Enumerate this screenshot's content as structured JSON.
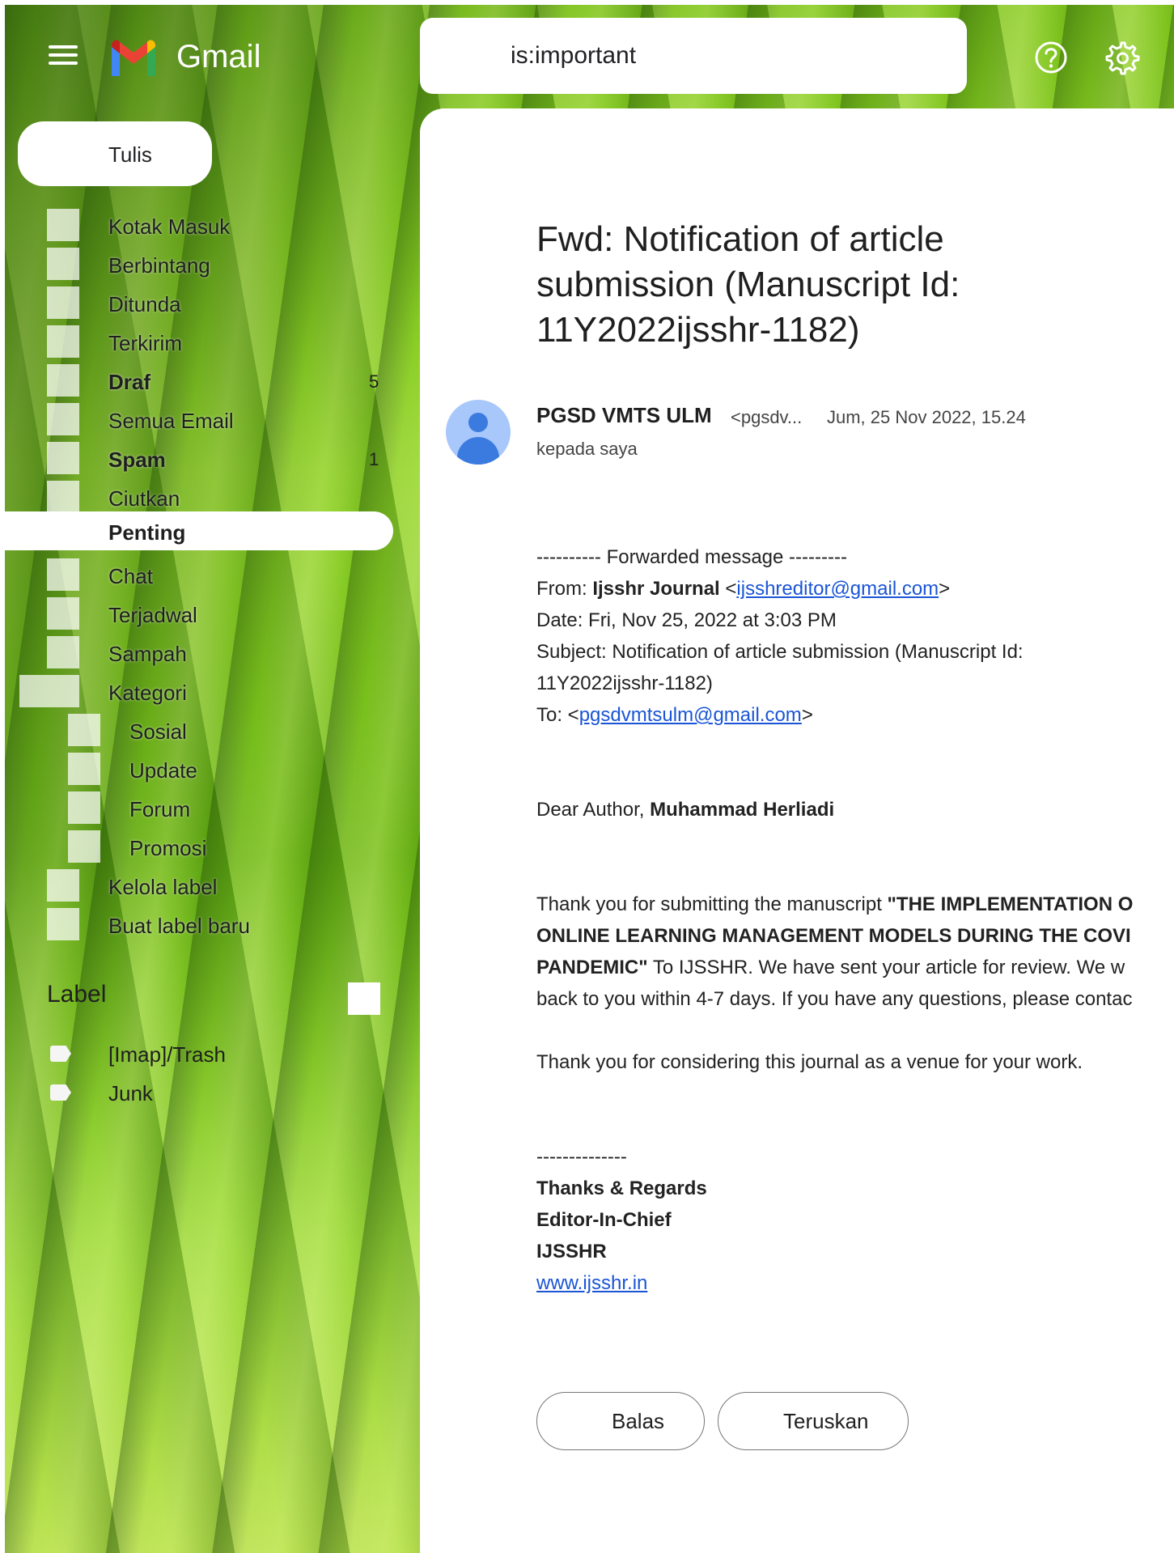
{
  "header": {
    "app_name": "Gmail",
    "search_value": "is:important"
  },
  "compose_label": "Tulis",
  "nav": [
    {
      "label": "Kotak Masuk",
      "count": "",
      "bold": false
    },
    {
      "label": "Berbintang",
      "count": "",
      "bold": false
    },
    {
      "label": "Ditunda",
      "count": "",
      "bold": false
    },
    {
      "label": "Terkirim",
      "count": "",
      "bold": false
    },
    {
      "label": "Draf",
      "count": "5",
      "bold": true
    },
    {
      "label": "Semua Email",
      "count": "",
      "bold": false
    },
    {
      "label": "Spam",
      "count": "1",
      "bold": true
    },
    {
      "label": "Ciutkan",
      "count": "",
      "bold": false
    },
    {
      "label": "Penting",
      "count": "",
      "bold": true,
      "active": true
    },
    {
      "label": "Chat",
      "count": "",
      "bold": false
    },
    {
      "label": "Terjadwal",
      "count": "",
      "bold": false
    },
    {
      "label": "Sampah",
      "count": "",
      "bold": false
    },
    {
      "label": "Kategori",
      "count": "",
      "bold": false
    },
    {
      "label": "Sosial",
      "count": "",
      "bold": false,
      "sub": true
    },
    {
      "label": "Update",
      "count": "",
      "bold": false,
      "sub": true
    },
    {
      "label": "Forum",
      "count": "",
      "bold": false,
      "sub": true
    },
    {
      "label": "Promosi",
      "count": "",
      "bold": false,
      "sub": true
    },
    {
      "label": "Kelola label",
      "count": "",
      "bold": false
    },
    {
      "label": "Buat label baru",
      "count": "",
      "bold": false
    }
  ],
  "labels": {
    "heading": "Label",
    "items": [
      "[Imap]/Trash",
      "Junk"
    ]
  },
  "email": {
    "subject": "Fwd: Notification of article submission (Manuscript Id: 11Y2022ijsshr-1182)",
    "sender_name": "PGSD VMTS ULM",
    "sender_email_short": "<pgsdv...",
    "date": "Jum, 25 Nov 2022, 15.24",
    "recipient": "kepada saya",
    "body": {
      "fwd_header": "---------- Forwarded message ---------",
      "from_label": "From: ",
      "from_name": "Ijsshr Journal",
      "from_email": "ijsshreditor@gmail.com",
      "date_line": "Date: Fri, Nov 25, 2022 at 3:03 PM",
      "subject_line_1": "Subject: Notification of article submission (Manuscript Id:",
      "subject_line_2": "11Y2022ijsshr-1182)",
      "to_label": "To: <",
      "to_email": "pgsdvmtsulm@gmail.com",
      "greeting": "Dear Author, ",
      "author": "Muhammad  Herliadi",
      "p1_l1_a": "Thank you for submitting the manuscript ",
      "p1_l1_b": "\"THE IMPLEMENTATION O",
      "p1_l2": "ONLINE LEARNING MANAGEMENT MODELS DURING THE COVI",
      "p1_l3_a": "PANDEMIC\"",
      "p1_l3_b": " To IJSSHR. We have sent your article for review. We w",
      "p1_l4": "back to you within 4-7 days. If you have any questions, please contac",
      "p2": "Thank you for considering this journal as a venue for your work.",
      "sep": "--------------",
      "sig1": "Thanks & Regards",
      "sig2": "Editor-In-Chief",
      "sig3": "IJSSHR",
      "site": "www.ijsshr.in"
    }
  },
  "actions": {
    "reply": "Balas",
    "forward": "Teruskan"
  }
}
